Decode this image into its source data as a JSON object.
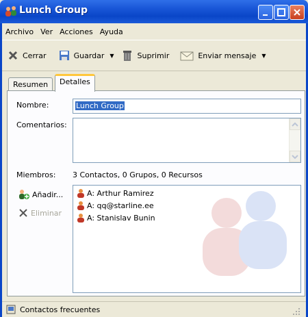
{
  "window": {
    "title": "Lunch Group"
  },
  "menu": [
    {
      "label": "Archivo"
    },
    {
      "label": "Ver"
    },
    {
      "label": "Acciones"
    },
    {
      "label": "Ayuda"
    }
  ],
  "toolbar": {
    "close_label": "Cerrar",
    "save_label": "Guardar",
    "delete_label": "Suprimir",
    "send_label": "Enviar mensaje"
  },
  "tabs": [
    {
      "label": "Resumen"
    },
    {
      "label": "Detalles"
    }
  ],
  "form": {
    "name_label": "Nombre:",
    "name_value": "Lunch Group",
    "comments_label": "Comentarios:",
    "comments_value": "",
    "members_label": "Miembros:",
    "members_summary": "3 Contactos, 0 Grupos, 0 Recursos",
    "add_label": "Añadir...",
    "remove_label": "Eliminar"
  },
  "members": [
    {
      "label": "A: Arthur Ramirez"
    },
    {
      "label": "A: qq@starline.ee"
    },
    {
      "label": "A: Stanislav Bunin"
    }
  ],
  "statusbar": {
    "text": "Contactos frecuentes"
  },
  "colors": {
    "titlebar": "#0a46c8",
    "selection": "#316ac5",
    "active_tab_accent": "#ffc73c"
  }
}
